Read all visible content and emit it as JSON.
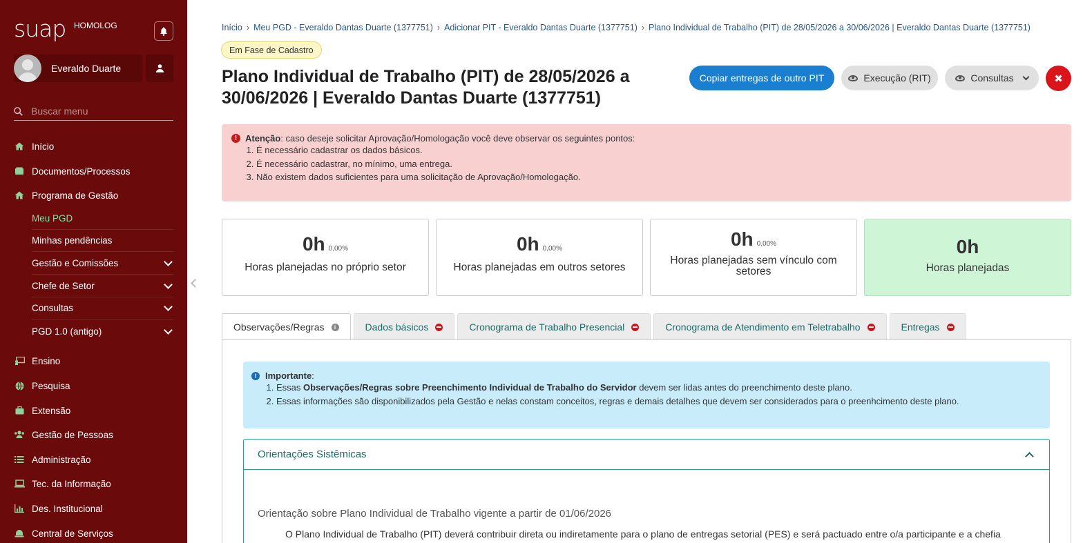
{
  "sidebar": {
    "brand": "suap",
    "environment": "HOMOLOG",
    "user_name": "Everaldo Duarte",
    "search_placeholder": "Buscar menu",
    "items": [
      {
        "label": "Início",
        "icon": "home-icon"
      },
      {
        "label": "Documentos/Processos",
        "icon": "documents-icon"
      },
      {
        "label": "Programa de Gestão",
        "icon": "house-icon"
      },
      {
        "label": "Ensino",
        "icon": "teacher-icon"
      },
      {
        "label": "Pesquisa",
        "icon": "globe-icon"
      },
      {
        "label": "Extensão",
        "icon": "briefcase-icon"
      },
      {
        "label": "Gestão de Pessoas",
        "icon": "users-icon"
      },
      {
        "label": "Administração",
        "icon": "list-icon"
      },
      {
        "label": "Tec. da Informação",
        "icon": "laptop-icon"
      },
      {
        "label": "Des. Institucional",
        "icon": "bar-chart-icon"
      },
      {
        "label": "Central de Serviços",
        "icon": "bell-icon"
      }
    ],
    "subitems": [
      {
        "label": "Meu PGD",
        "active": true
      },
      {
        "label": "Minhas pendências"
      },
      {
        "label": "Gestão e Comissões"
      },
      {
        "label": "Chefe de Setor"
      },
      {
        "label": "Consultas"
      },
      {
        "label": "PGD 1.0 (antigo)"
      }
    ]
  },
  "breadcrumb": [
    "Início",
    "Meu PGD - Everaldo Dantas Duarte (1377751)",
    "Adicionar PIT - Everaldo Dantas Duarte (1377751)",
    "Plano Individual de Trabalho (PIT) de 28/05/2026 a 30/06/2026 | Everaldo Dantas Duarte (1377751)"
  ],
  "status": "Em Fase de Cadastro",
  "title": "Plano Individual de Trabalho (PIT) de 28/05/2026 a 30/06/2026 | Everaldo Dantas Duarte (1377751)",
  "actions": {
    "copy": "Copiar entregas de outro PIT",
    "execucao": "Execução (RIT)",
    "consultas": "Consultas",
    "close": "✖"
  },
  "alert": {
    "title": "Atenção",
    "text": ": caso deseje solicitar Aprovação/Homologação você deve observar os seguintes pontos:",
    "items": [
      "É necessário cadastrar os dados básicos.",
      "É necessário cadastrar, no mínimo, uma entrega.",
      "Não existem dados suficientes para uma solicitação de Aprovação/Homologação."
    ]
  },
  "stats": [
    {
      "value": "0h",
      "pct": "0,00%",
      "label": "Horas planejadas no próprio setor"
    },
    {
      "value": "0h",
      "pct": "0,00%",
      "label": "Horas planejadas em outros setores"
    },
    {
      "value": "0h",
      "pct": "0,00%",
      "label": "Horas planejadas sem vínculo com setores"
    },
    {
      "value": "0h",
      "pct": "",
      "label": "Horas planejadas"
    }
  ],
  "tabs": [
    {
      "label": "Observações/Regras"
    },
    {
      "label": "Dados básicos"
    },
    {
      "label": "Cronograma de Trabalho Presencial"
    },
    {
      "label": "Cronograma de Atendimento em Teletrabalho"
    },
    {
      "label": "Entregas"
    }
  ],
  "info": {
    "title": "Importante",
    "item1_prefix": "Essas ",
    "item1_bold": "Observações/Regras sobre Preenchimento Individual de Trabalho do Servidor",
    "item1_suffix": " devem ser lidas antes do preenchimento deste plano.",
    "item2": "Essas informações são disponibilizados pela Gestão e nelas constam conceitos, regras e demais detalhes que devem ser considerados para o preenhcimento deste plano."
  },
  "accordion": {
    "title": "Orientações Sistêmicas",
    "subtitle": "Orientação sobre Plano Individual de Trabalho vigente a partir de 01/06/2026",
    "text": "O Plano Individual de Trabalho (PIT) deverá contribuir direta ou indiretamente para o plano de entregas setorial (PES) e será pactuado entre o/a participante e a chefia"
  }
}
